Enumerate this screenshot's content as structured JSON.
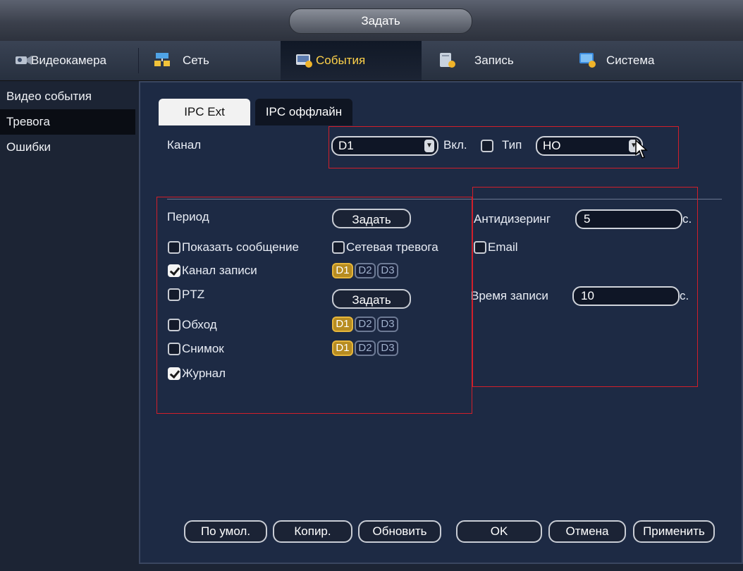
{
  "window": {
    "title": "Задать"
  },
  "tabs": [
    {
      "label": "Видеокамера",
      "icon": "camera-icon",
      "active": false
    },
    {
      "label": "Сеть",
      "icon": "network-icon",
      "active": false
    },
    {
      "label": "События",
      "icon": "events-icon",
      "active": true
    },
    {
      "label": "Запись",
      "icon": "record-icon",
      "active": false
    },
    {
      "label": "Система",
      "icon": "system-icon",
      "active": false
    }
  ],
  "sidebar": {
    "items": [
      {
        "label": "Видео события",
        "active": false
      },
      {
        "label": "Тревога",
        "active": true
      },
      {
        "label": "Ошибки",
        "active": false
      }
    ]
  },
  "subtabs": [
    {
      "label": "IPC Ext",
      "active": true
    },
    {
      "label": "IPC оффлайн",
      "active": false
    }
  ],
  "channel": {
    "label": "Канал",
    "value": "D1",
    "enable_label": "Вкл.",
    "enable_checked": false,
    "type_label": "Тип",
    "type_value": "НО"
  },
  "left": {
    "period_label": "Период",
    "period_button": "Задать",
    "show_message_label": "Показать сообщение",
    "show_message_checked": false,
    "network_alarm_label": "Сетевая тревога",
    "network_alarm_checked": false,
    "record_channel_label": "Канал записи",
    "record_channel_checked": true,
    "record_channels": [
      {
        "label": "D1",
        "on": true
      },
      {
        "label": "D2",
        "on": false
      },
      {
        "label": "D3",
        "on": false
      }
    ],
    "ptz_label": "PTZ",
    "ptz_checked": false,
    "ptz_button": "Задать",
    "tour_label": "Обход",
    "tour_checked": false,
    "tour_channels": [
      {
        "label": "D1",
        "on": true
      },
      {
        "label": "D2",
        "on": false
      },
      {
        "label": "D3",
        "on": false
      }
    ],
    "snapshot_label": "Снимок",
    "snapshot_checked": false,
    "snapshot_channels": [
      {
        "label": "D1",
        "on": true
      },
      {
        "label": "D2",
        "on": false
      },
      {
        "label": "D3",
        "on": false
      }
    ],
    "log_label": "Журнал",
    "log_checked": true
  },
  "right": {
    "antidither_label": "Антидизеринг",
    "antidither_value": "5",
    "antidither_unit": "с.",
    "email_label": "Email",
    "email_checked": false,
    "record_time_label": "Время записи",
    "record_time_value": "10",
    "record_time_unit": "с."
  },
  "footer": {
    "default": "По умол.",
    "copy": "Копир.",
    "refresh": "Обновить",
    "ok": "OK",
    "cancel": "Отмена",
    "apply": "Применить"
  },
  "colors": {
    "accent": "#ffd24a",
    "highlight_box": "#d11f2a",
    "panel": "#1d2a44"
  }
}
